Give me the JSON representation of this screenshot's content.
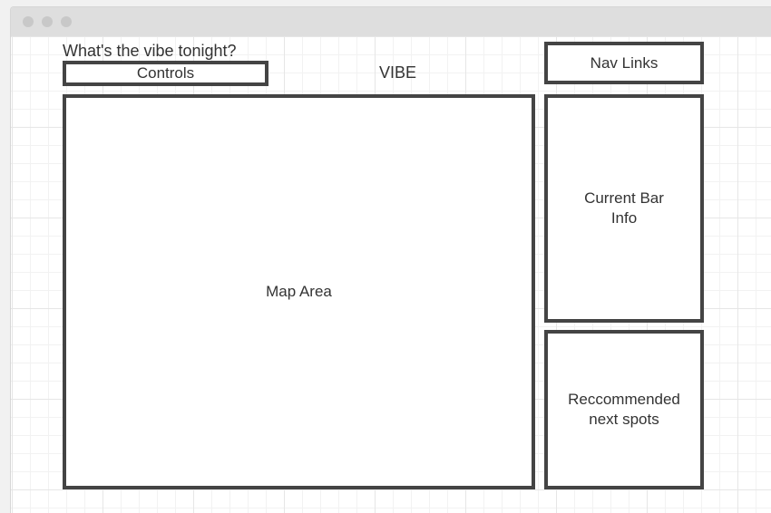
{
  "diagram": {
    "question": "What's the vibe tonight?",
    "brand": "VIBE",
    "controls": "Controls",
    "nav_links": "Nav Links",
    "map_area": "Map Area",
    "current_bar_info": "Current Bar\nInfo",
    "recommended_spots": "Reccommended\nnext spots"
  },
  "colors": {
    "box_border": "#444444",
    "text": "#333333",
    "grid_major": "#e6e6e6",
    "grid_minor": "#f2f2f2",
    "titlebar": "#dedede",
    "window_dot": "#c8c8c8"
  },
  "icons": [
    "window-dot-icon",
    "window-dot-icon",
    "window-dot-icon"
  ]
}
